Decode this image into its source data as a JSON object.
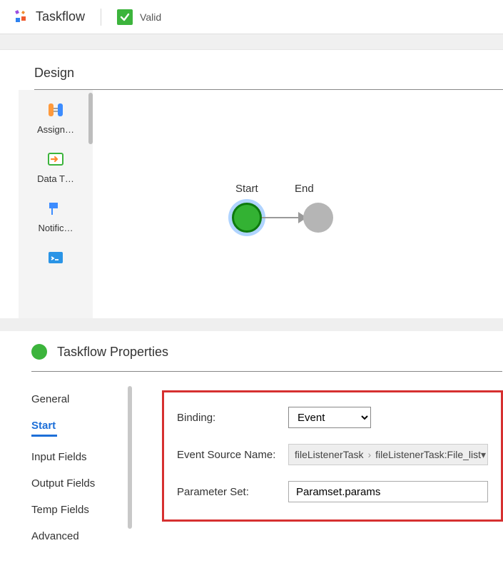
{
  "topbar": {
    "brand": "Taskflow",
    "valid_label": "Valid"
  },
  "design": {
    "heading": "Design",
    "palette": [
      {
        "label": "Assign…"
      },
      {
        "label": "Data T…"
      },
      {
        "label": "Notific…"
      },
      {
        "label": ""
      }
    ],
    "nodes": {
      "start_label": "Start",
      "end_label": "End"
    }
  },
  "properties": {
    "title": "Taskflow Properties",
    "tabs": {
      "general": "General",
      "start": "Start",
      "input_fields": "Input Fields",
      "output_fields": "Output Fields",
      "temp_fields": "Temp Fields",
      "advanced": "Advanced"
    },
    "form": {
      "binding_label": "Binding:",
      "binding_value": "Event",
      "event_source_label": "Event Source Name:",
      "event_source_crumb1": "fileListenerTask",
      "event_source_crumb2": "fileListenerTask:File_list",
      "param_set_label": "Parameter Set:",
      "param_set_value": "Paramset.params"
    }
  }
}
